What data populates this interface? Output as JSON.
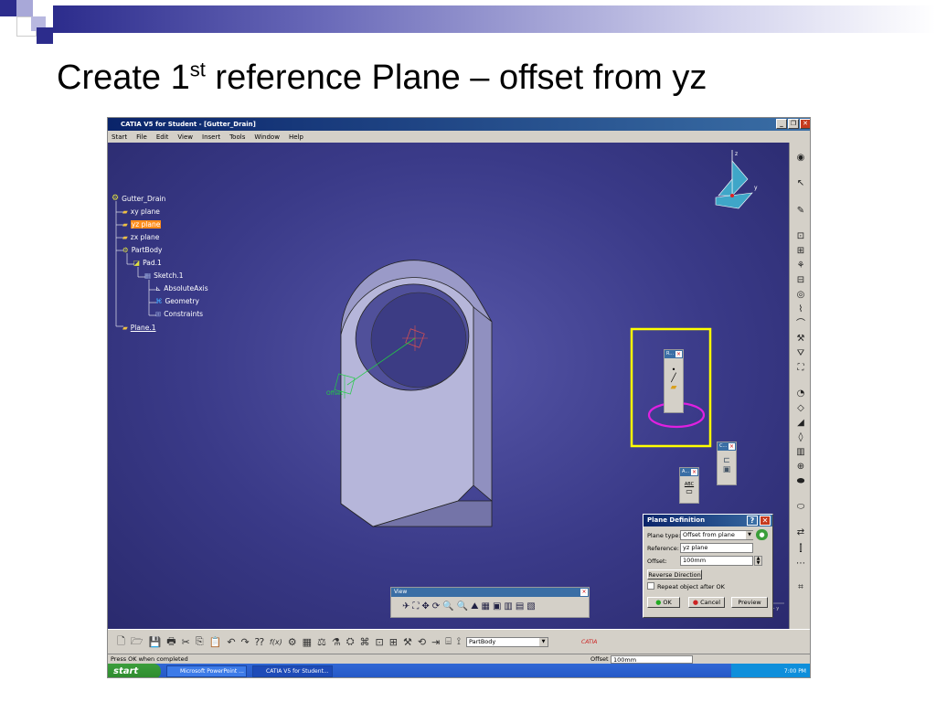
{
  "slide": {
    "title_main": "Create 1",
    "title_sup": "st",
    "title_rest": " reference Plane – offset from yz"
  },
  "window": {
    "title": "CATIA V5 for Student - [Gutter_Drain]",
    "controls": [
      "_",
      "❐",
      "✕"
    ]
  },
  "menu": [
    "Start",
    "File",
    "Edit",
    "View",
    "Insert",
    "Tools",
    "Window",
    "Help"
  ],
  "tree": {
    "root": "Gutter_Drain",
    "items": [
      "xy plane",
      "yz plane",
      "zx plane",
      "PartBody",
      "Pad.1",
      "Sketch.1",
      "AbsoluteAxis",
      "Geometry",
      "Constraints",
      "Plane.1"
    ]
  },
  "model": {
    "axis_label": "Offset",
    "compass_labels": [
      "z",
      "y"
    ]
  },
  "palettes": {
    "p1_title": "R...",
    "p2_title": "C...",
    "p3_title": "A...",
    "p3_text": "ABC"
  },
  "view_toolbar": {
    "title": "View",
    "icons": [
      "✈",
      "⛶",
      "✥",
      "⟳",
      "🔍",
      "🔍",
      "⛰",
      "▦",
      "▣",
      "▥",
      "▤",
      "▧"
    ]
  },
  "plane_dialog": {
    "title": "Plane Definition",
    "plane_type_label": "Plane type:",
    "plane_type_value": "Offset from plane",
    "reference_label": "Reference:",
    "reference_value": "yz plane",
    "offset_label": "Offset:",
    "offset_value": "100mm",
    "reverse_label": "Reverse Direction",
    "repeat_label": "Repeat object after OK",
    "ok_label": "OK",
    "cancel_label": "Cancel",
    "preview_label": "Preview"
  },
  "bottom_toolbar": {
    "icons": [
      "🗋",
      "🗁",
      "💾",
      "🖶",
      "✂",
      "⎘",
      "📋",
      "↶",
      "↷",
      "⁇",
      "f(x)",
      "⚙",
      "▦",
      "⚖",
      "⚗",
      "⛭",
      "⌘",
      "⊡",
      "⊞",
      "⚒",
      "⟲",
      "⇥",
      "⌸",
      "⟟"
    ],
    "body_select": "PartBody",
    "catia_label": "CATIA"
  },
  "status": {
    "message": "Press OK when completed",
    "field_label": "Offset",
    "field_value": "100mm"
  },
  "taskbar": {
    "start": "start",
    "tasks": [
      "Microsoft PowerPoint ...",
      "CATIA V5 for Student..."
    ],
    "clock": "7:00 PM"
  },
  "colors": {
    "highlight_box": "#ffff00",
    "highlight_ellipse": "#e020e0",
    "selection": "#ff8c1a"
  }
}
